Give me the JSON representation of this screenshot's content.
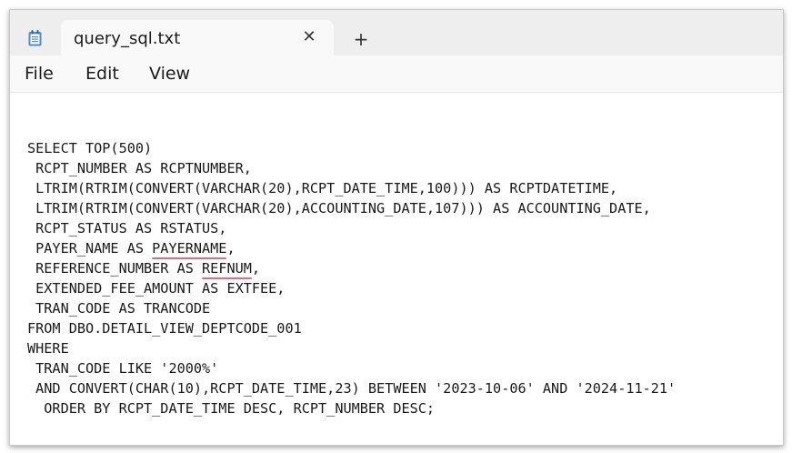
{
  "tab": {
    "title": "query_sql.txt",
    "close_glyph": "✕",
    "new_tab_glyph": "+"
  },
  "menu": {
    "file": "File",
    "edit": "Edit",
    "view": "View"
  },
  "icons": {
    "app": "notepad-icon",
    "close": "close-icon",
    "new_tab": "plus-icon"
  },
  "colors": {
    "tabbar": "#eeeeee",
    "tab_active": "#f9f9f9",
    "spellcheck_underline": "#e06c7a"
  },
  "editor": {
    "lines": [
      "SELECT TOP(500)",
      " RCPT_NUMBER AS RCPTNUMBER,",
      " LTRIM(RTRIM(CONVERT(VARCHAR(20),RCPT_DATE_TIME,100))) AS RCPTDATETIME,",
      " LTRIM(RTRIM(CONVERT(VARCHAR(20),ACCOUNTING_DATE,107))) AS ACCOUNTING_DATE,",
      " RCPT_STATUS AS RSTATUS,",
      {
        "pre": " PAYER_NAME AS ",
        "flag": "PAYERNAME",
        "post": ","
      },
      {
        "pre": " REFERENCE_NUMBER AS ",
        "flag": "REFNUM",
        "post": ","
      },
      " EXTENDED_FEE_AMOUNT AS EXTFEE,",
      " TRAN_CODE AS TRANCODE",
      "FROM DBO.DETAIL_VIEW_DEPTCODE_001",
      "WHERE",
      " TRAN_CODE LIKE '2000%'",
      " AND CONVERT(CHAR(10),RCPT_DATE_TIME,23) BETWEEN '2023-10-06' AND '2024-11-21'",
      "  ORDER BY RCPT_DATE_TIME DESC, RCPT_NUMBER DESC;"
    ]
  }
}
